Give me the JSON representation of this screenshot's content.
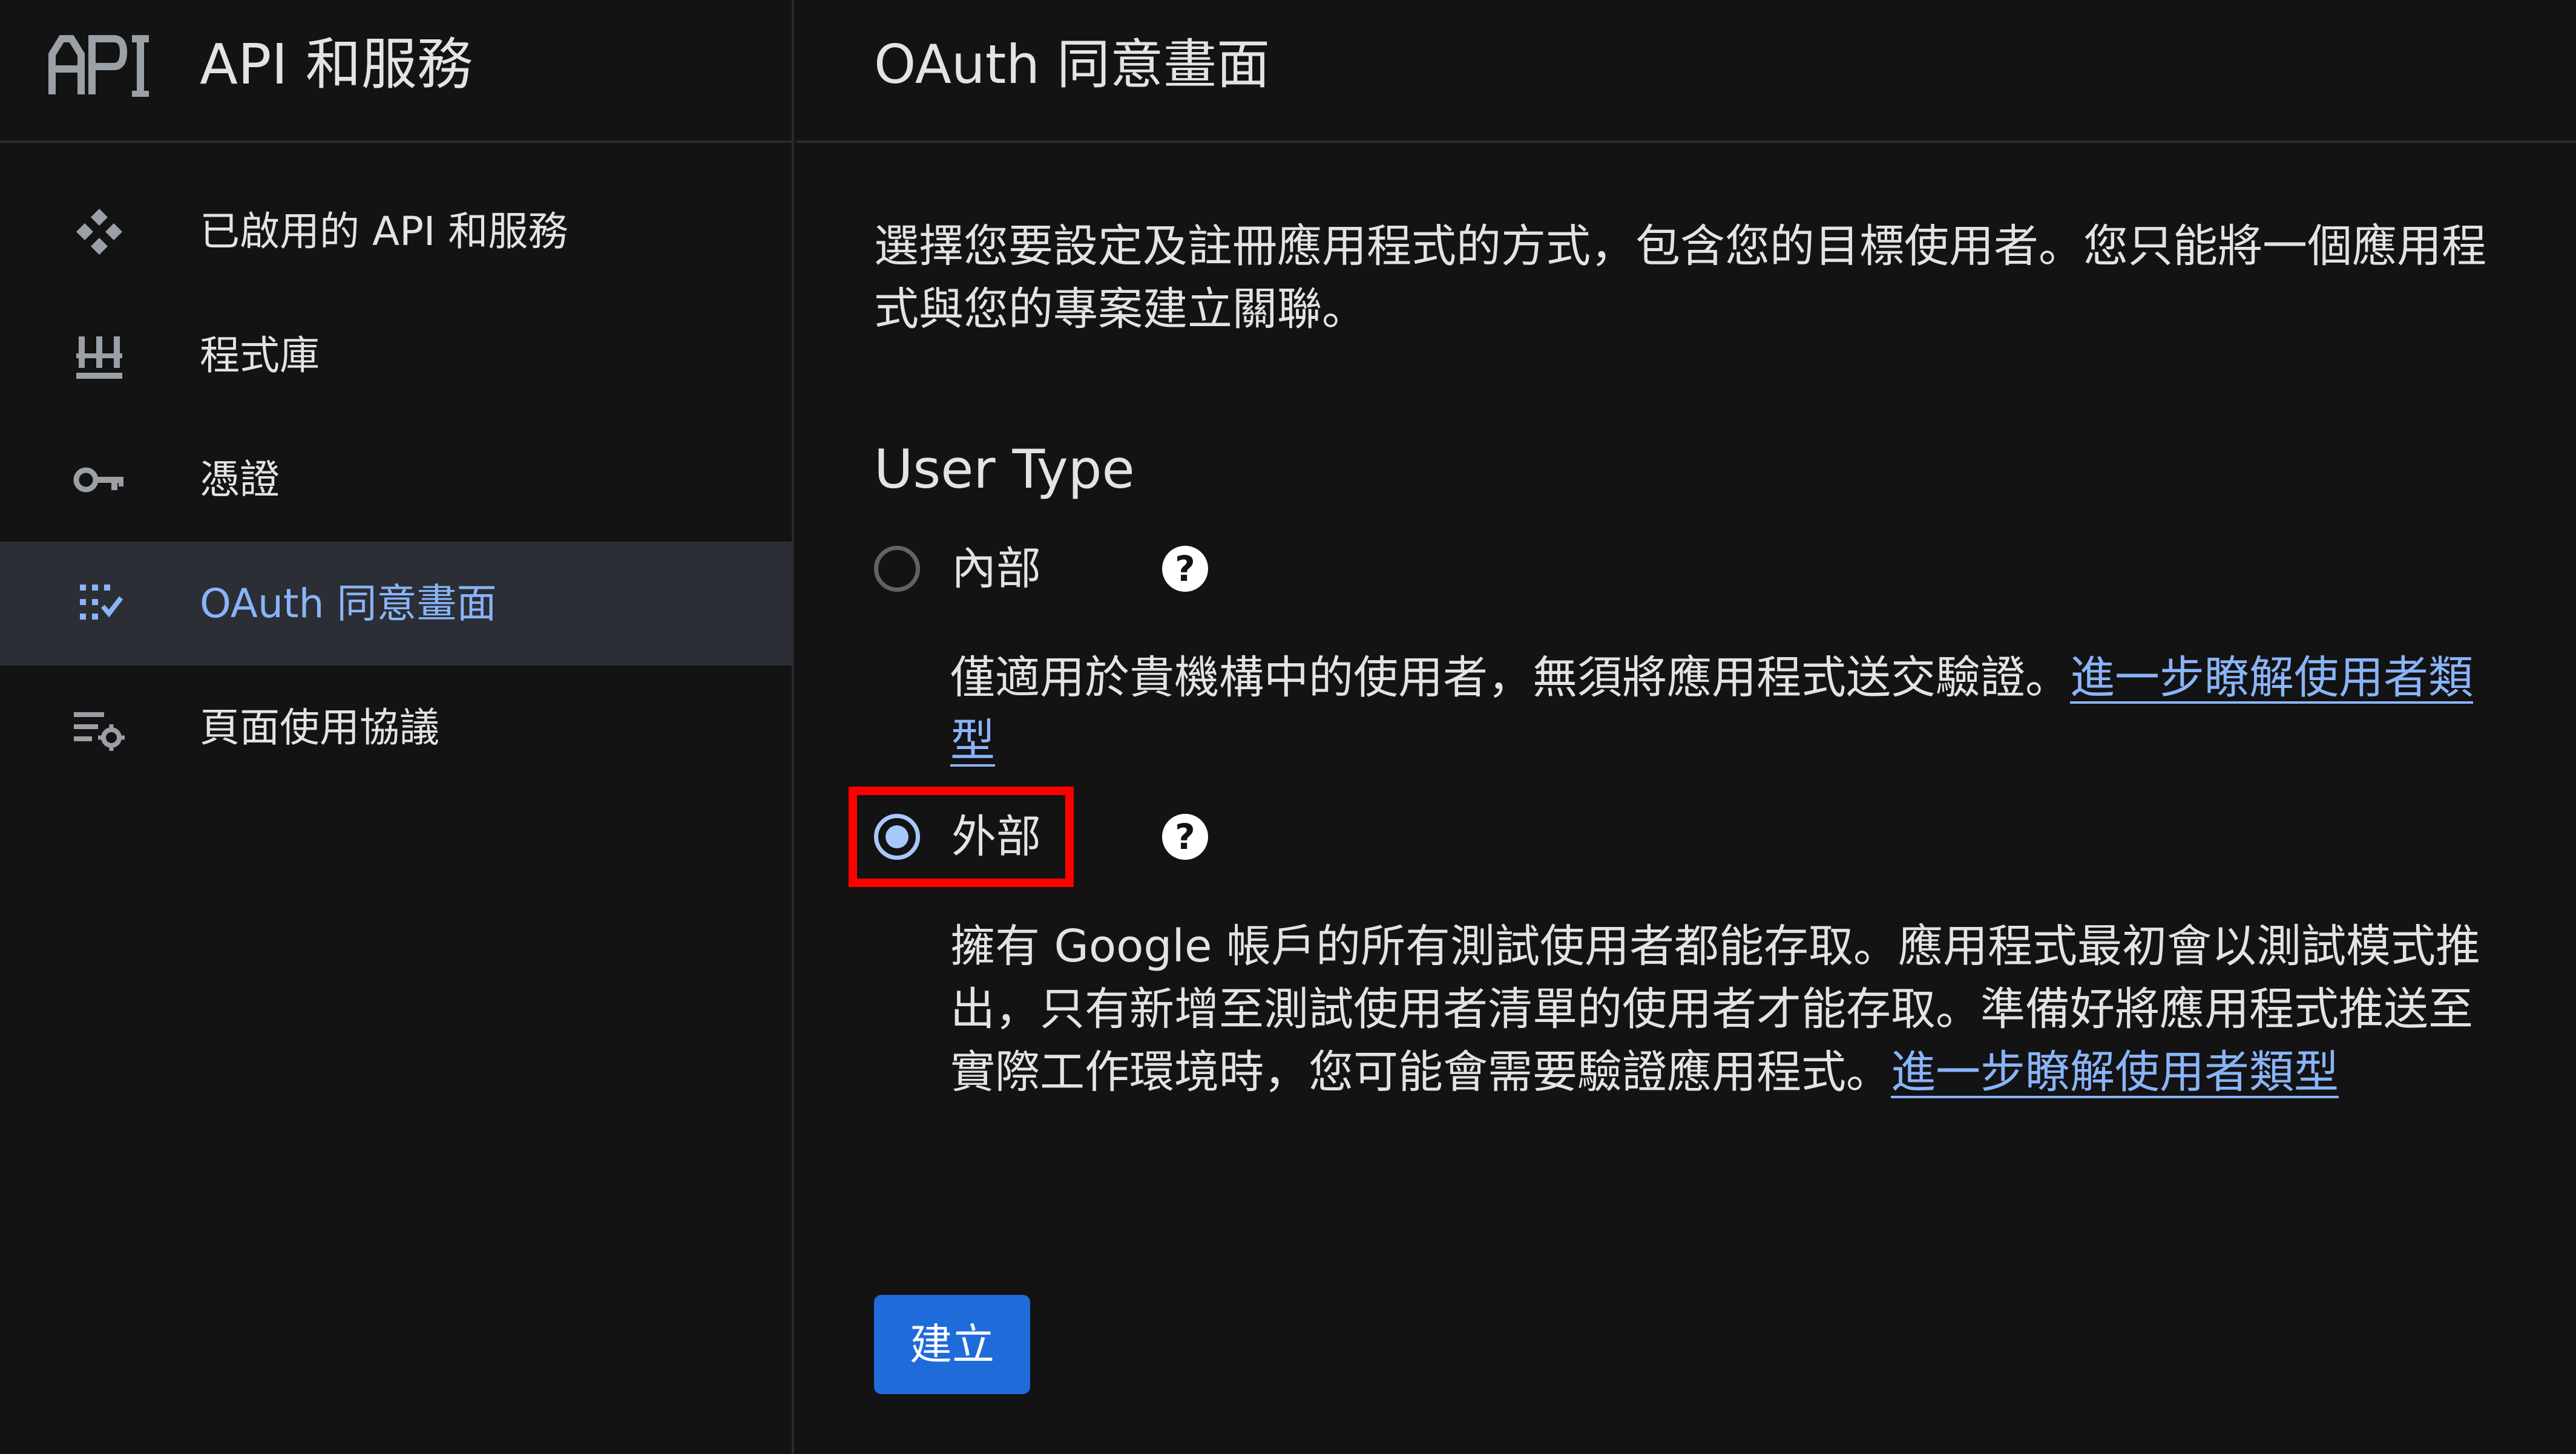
{
  "sidebar": {
    "logo_icon": "api-logo-icon",
    "product_title": "API 和服務",
    "items": [
      {
        "label": "已啟用的 API 和服務",
        "icon": "api-services-icon",
        "active": false
      },
      {
        "label": "程式庫",
        "icon": "library-icon",
        "active": false
      },
      {
        "label": "憑證",
        "icon": "key-icon",
        "active": false
      },
      {
        "label": "OAuth 同意畫面",
        "icon": "oauth-consent-icon",
        "active": true
      },
      {
        "label": "頁面使用協議",
        "icon": "page-settings-icon",
        "active": false
      }
    ]
  },
  "main": {
    "page_title": "OAuth 同意畫面",
    "description": "選擇您要設定及註冊應用程式的方式，包含您的目標使用者。您只能將一個應用程式與您的專案建立關聯。",
    "user_type": {
      "title": "User Type",
      "options": [
        {
          "label": "內部",
          "checked": false,
          "help_icon": "?",
          "description": "僅適用於貴機構中的使用者，無須將應用程式送交驗證。",
          "link": "進一步瞭解使用者類型"
        },
        {
          "label": "外部",
          "checked": true,
          "help_icon": "?",
          "description": "擁有 Google 帳戶的所有測試使用者都能存取。應用程式最初會以測試模式推出，只有新增至測試使用者清單的使用者才能存取。準備好將應用程式推送至實際工作環境時，您可能會需要驗證應用程式。",
          "link": "進一步瞭解使用者類型"
        }
      ]
    },
    "create_button": "建立"
  },
  "colors": {
    "background": "#131314",
    "active_nav_bg": "#2b2e35",
    "accent": "#8ab4f8",
    "button": "#1f6bd9",
    "highlight": "#ff0000"
  }
}
